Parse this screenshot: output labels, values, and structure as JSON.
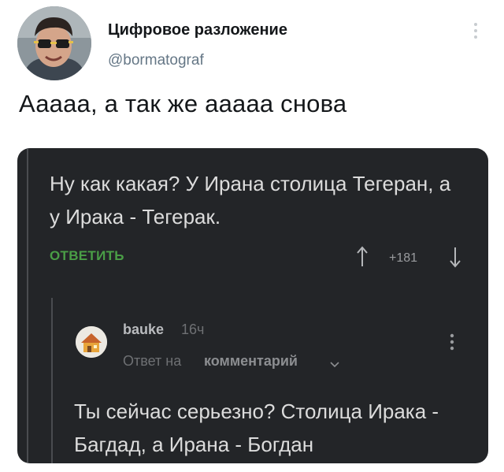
{
  "tweet": {
    "author_name": "Цифровое разложение",
    "author_handle": "@bormatograf",
    "text": "Ааааа, а так же ааааа снова",
    "more_icon": "vertical-dots-icon"
  },
  "screenshot": {
    "comment_main": {
      "text": "Ну как какая? У Ирана столица Тегеран, а у Ирака - Тегерак.",
      "reply_label": "ОТВЕТИТЬ",
      "rating": "+181",
      "upvote_icon": "arrow-up-icon",
      "downvote_icon": "arrow-down-icon"
    },
    "comment_reply": {
      "username": "bauke",
      "time": "16ч",
      "reply_prefix": "Ответ на",
      "reply_target": "комментарий",
      "text": "Ты сейчас серьезно? Столица Ирака - Багдад, а Ирана - Богдан",
      "more_icon": "vertical-dots-icon",
      "chevron_icon": "chevron-down-icon"
    }
  },
  "colors": {
    "card_bg": "#232528",
    "accent_green": "#4a9e46",
    "handle_gray": "#657786"
  }
}
